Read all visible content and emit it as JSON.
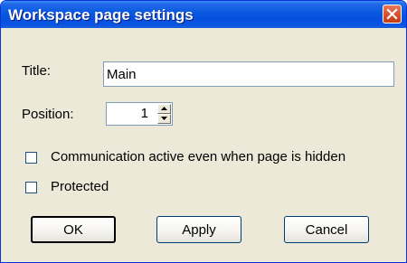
{
  "window": {
    "title": "Workspace page settings"
  },
  "form": {
    "title_label": "Title:",
    "title_value": "Main",
    "position_label": "Position:",
    "position_value": "1",
    "checkbox_communication_label": "Communication active even when page is hidden",
    "checkbox_communication_checked": false,
    "checkbox_protected_label": "Protected",
    "checkbox_protected_checked": false
  },
  "buttons": {
    "ok": "OK",
    "apply": "Apply",
    "cancel": "Cancel"
  }
}
